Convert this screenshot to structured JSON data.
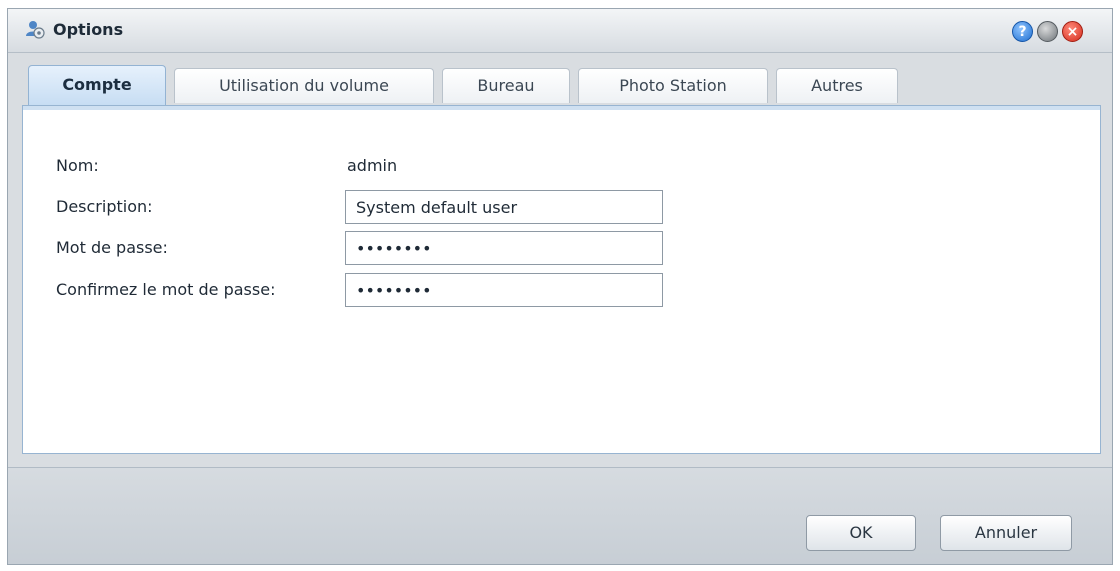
{
  "window": {
    "title": "Options",
    "controls": {
      "help": "?",
      "minimize": "",
      "close": "×"
    }
  },
  "tabs": [
    {
      "label": "Compte",
      "active": true
    },
    {
      "label": "Utilisation du volume",
      "active": false
    },
    {
      "label": "Bureau",
      "active": false
    },
    {
      "label": "Photo Station",
      "active": false
    },
    {
      "label": "Autres",
      "active": false
    }
  ],
  "account": {
    "name_label": "Nom:",
    "name_value": "admin",
    "description_label": "Description:",
    "description_value": "System default user",
    "password_label": "Mot de passe:",
    "password_value": "••••••••",
    "confirm_label": "Confirmez le mot de passe:",
    "confirm_value": "••••••••"
  },
  "footer": {
    "ok_label": "OK",
    "cancel_label": "Annuler"
  },
  "colors": {
    "active_tab": "#c7ddf3",
    "panel_border": "#97b4d1",
    "close": "#d42b1c",
    "help": "#1f6fd0"
  },
  "icons": {
    "app": "user-settings-icon",
    "help": "help-icon",
    "minimize": "minimize-icon",
    "close": "close-icon"
  }
}
